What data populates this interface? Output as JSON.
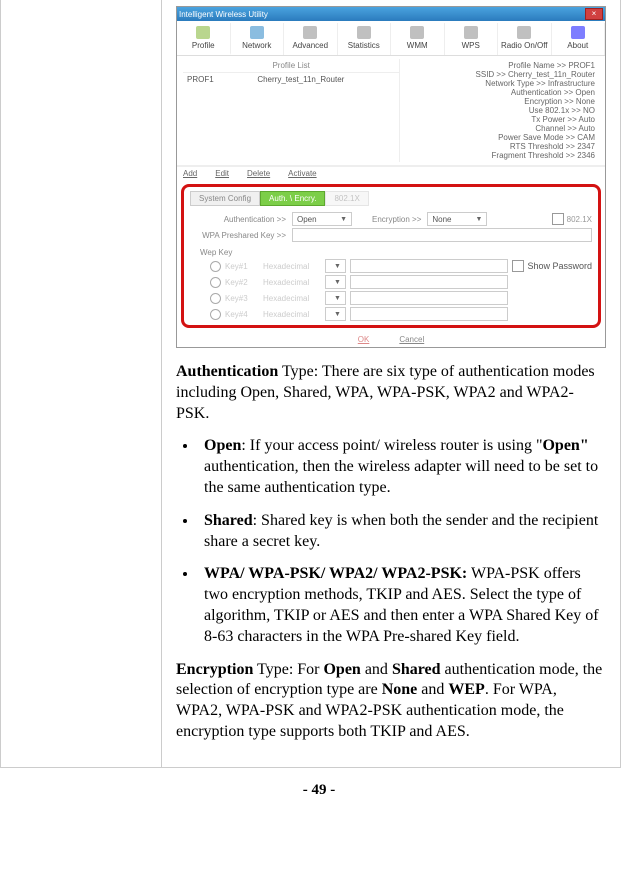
{
  "screenshot": {
    "window_title": "Intelligent Wireless Utility",
    "tabs": [
      "Profile",
      "Network",
      "Advanced",
      "Statistics",
      "WMM",
      "WPS",
      "Radio On/Off",
      "About"
    ],
    "profile_list_header": "Profile List",
    "profile_row": {
      "name": "PROF1",
      "ssid": "Cherry_test_11n_Router"
    },
    "details": {
      "profile_name_lbl": "Profile Name >> ",
      "profile_name": "PROF1",
      "ssid_lbl": "SSID >> ",
      "ssid": "Cherry_test_11n_Router",
      "network_type_lbl": "Network Type >> ",
      "network_type": "Infrastructure",
      "auth_lbl": "Authentication >> ",
      "auth": "Open",
      "encr_lbl": "Encryption >> ",
      "encr": "None",
      "use8021x_lbl": "Use 802.1x >> ",
      "use8021x": "NO",
      "txpower_lbl": "Tx Power >> ",
      "txpower": "Auto",
      "channel_lbl": "Channel >> ",
      "channel": "Auto",
      "psm_lbl": "Power Save Mode >> ",
      "psm": "CAM",
      "rts_lbl": "RTS Threshold >> ",
      "rts": "2347",
      "frag_lbl": "Fragment Threshold >> ",
      "frag": "2346"
    },
    "actions": {
      "add": "Add",
      "edit": "Edit",
      "delete": "Delete",
      "activate": "Activate"
    },
    "subtabs": {
      "sys": "System Config",
      "auth": "Auth. \\ Encry.",
      "x": "802.1X"
    },
    "form": {
      "auth_lbl": "Authentication >>",
      "auth_val": "Open",
      "encr_lbl": "Encryption >>",
      "encr_val": "None",
      "x_chk": "802.1X",
      "psk_lbl": "WPA Preshared Key >>",
      "wep_lbl": "Wep Key",
      "keys": [
        "Key#1",
        "Key#2",
        "Key#3",
        "Key#4"
      ],
      "mode": "Hexadecimal",
      "show_pw": "Show Password"
    },
    "ok": "OK",
    "cancel": "Cancel"
  },
  "doc": {
    "p1_a": "Authentication",
    "p1_b": " Type: There are six type of authentication modes including Open, Shared, WPA, WPA-PSK, WPA2 and WPA2-PSK.",
    "open_b": "Open",
    "open_t1": ": If your access point/ wireless router is using \"",
    "open_q": "Open\"",
    "open_t2": " authentication, then the wireless adapter will need to be set to the same authentication type.",
    "shared_b": "Shared",
    "shared_t": ": Shared key is when both the sender and the recipient share a secret key.",
    "wpa_b": "WPA/ WPA-PSK/ WPA2/ WPA2-PSK:",
    "wpa_t": " WPA-PSK offers two encryption methods, TKIP and AES. Select the type of algorithm, TKIP or AES and then enter a WPA Shared Key of 8-63 characters in the WPA Pre-shared Key field.",
    "enc_a": "Encryption",
    "enc_b": " Type: For ",
    "enc_open": "Open",
    "enc_c": " and ",
    "enc_shared": "Shared",
    "enc_d": " authentication mode, the selection of encryption type are ",
    "enc_none": "None",
    "enc_e": " and ",
    "enc_wep": "WEP",
    "enc_f": ". For WPA, WPA2, WPA-PSK and WPA2-PSK authentication mode, the encryption type supports both TKIP and AES.",
    "page": "- 49 -"
  }
}
